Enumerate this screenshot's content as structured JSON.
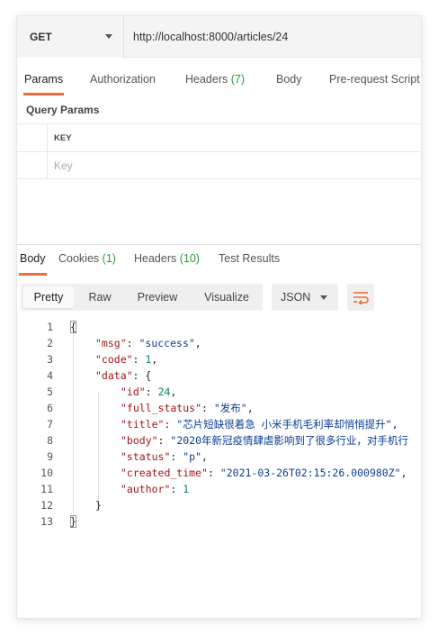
{
  "request": {
    "method": "GET",
    "url": "http://localhost:8000/articles/24"
  },
  "request_tabs": [
    {
      "label": "Params",
      "active": true
    },
    {
      "label": "Authorization"
    },
    {
      "label": "Headers",
      "count": "(7)"
    },
    {
      "label": "Body"
    },
    {
      "label": "Pre-request Script"
    }
  ],
  "query_params": {
    "title": "Query Params",
    "column_header": "KEY",
    "key_placeholder": "Key"
  },
  "response_tabs": [
    {
      "label": "Body",
      "active": true
    },
    {
      "label": "Cookies",
      "count": "(1)"
    },
    {
      "label": "Headers",
      "count": "(10)"
    },
    {
      "label": "Test Results"
    }
  ],
  "view_modes": [
    "Pretty",
    "Raw",
    "Preview",
    "Visualize"
  ],
  "active_view": "Pretty",
  "format": "JSON",
  "icons": {
    "method_dropdown": "chevron-down-icon",
    "format_dropdown": "chevron-down-icon",
    "wrap": "wrap-lines-icon"
  },
  "colors": {
    "accent": "#f26b3a",
    "count": "#2a9b3c",
    "json_key": "#a31515",
    "json_string": "#0b3d91",
    "json_number": "#098658"
  },
  "response_lines": [
    {
      "n": "1",
      "tokens": [
        {
          "t": "{",
          "c": "p"
        }
      ]
    },
    {
      "n": "2",
      "tokens": [
        {
          "t": "\"msg\"",
          "c": "key"
        },
        {
          "t": ": ",
          "c": "p"
        },
        {
          "t": "\"success\"",
          "c": "str"
        },
        {
          "t": ",",
          "c": "p"
        }
      ]
    },
    {
      "n": "3",
      "tokens": [
        {
          "t": "\"code\"",
          "c": "key"
        },
        {
          "t": ": ",
          "c": "p"
        },
        {
          "t": "1",
          "c": "num"
        },
        {
          "t": ",",
          "c": "p"
        }
      ]
    },
    {
      "n": "4",
      "tokens": [
        {
          "t": "\"data\"",
          "c": "key"
        },
        {
          "t": ": {",
          "c": "p"
        }
      ]
    },
    {
      "n": "5",
      "tokens": [
        {
          "t": "\"id\"",
          "c": "key"
        },
        {
          "t": ": ",
          "c": "p"
        },
        {
          "t": "24",
          "c": "num"
        },
        {
          "t": ",",
          "c": "p"
        }
      ]
    },
    {
      "n": "6",
      "tokens": [
        {
          "t": "\"full_status\"",
          "c": "key"
        },
        {
          "t": ": ",
          "c": "p"
        },
        {
          "t": "\"发布\"",
          "c": "str"
        },
        {
          "t": ",",
          "c": "p"
        }
      ]
    },
    {
      "n": "7",
      "tokens": [
        {
          "t": "\"title\"",
          "c": "key"
        },
        {
          "t": ": ",
          "c": "p"
        },
        {
          "t": "\"芯片短缺很着急 小米手机毛利率却悄悄提升\"",
          "c": "str"
        },
        {
          "t": ",",
          "c": "p"
        }
      ]
    },
    {
      "n": "8",
      "tokens": [
        {
          "t": "\"body\"",
          "c": "key"
        },
        {
          "t": ": ",
          "c": "p"
        },
        {
          "t": "\"2020年新冠疫情肆虐影响到了很多行业，对手机行",
          "c": "str"
        }
      ]
    },
    {
      "n": "9",
      "tokens": [
        {
          "t": "\"status\"",
          "c": "key"
        },
        {
          "t": ": ",
          "c": "p"
        },
        {
          "t": "\"p\"",
          "c": "str"
        },
        {
          "t": ",",
          "c": "p"
        }
      ]
    },
    {
      "n": "10",
      "tokens": [
        {
          "t": "\"created_time\"",
          "c": "key"
        },
        {
          "t": ": ",
          "c": "p"
        },
        {
          "t": "\"2021-03-26T02:15:26.000980Z\"",
          "c": "str"
        },
        {
          "t": ",",
          "c": "p"
        }
      ]
    },
    {
      "n": "11",
      "tokens": [
        {
          "t": "\"author\"",
          "c": "key"
        },
        {
          "t": ": ",
          "c": "p"
        },
        {
          "t": "1",
          "c": "num"
        }
      ]
    },
    {
      "n": "12",
      "tokens": [
        {
          "t": "}",
          "c": "p"
        }
      ]
    },
    {
      "n": "13",
      "tokens": [
        {
          "t": "}",
          "c": "p"
        }
      ]
    }
  ]
}
